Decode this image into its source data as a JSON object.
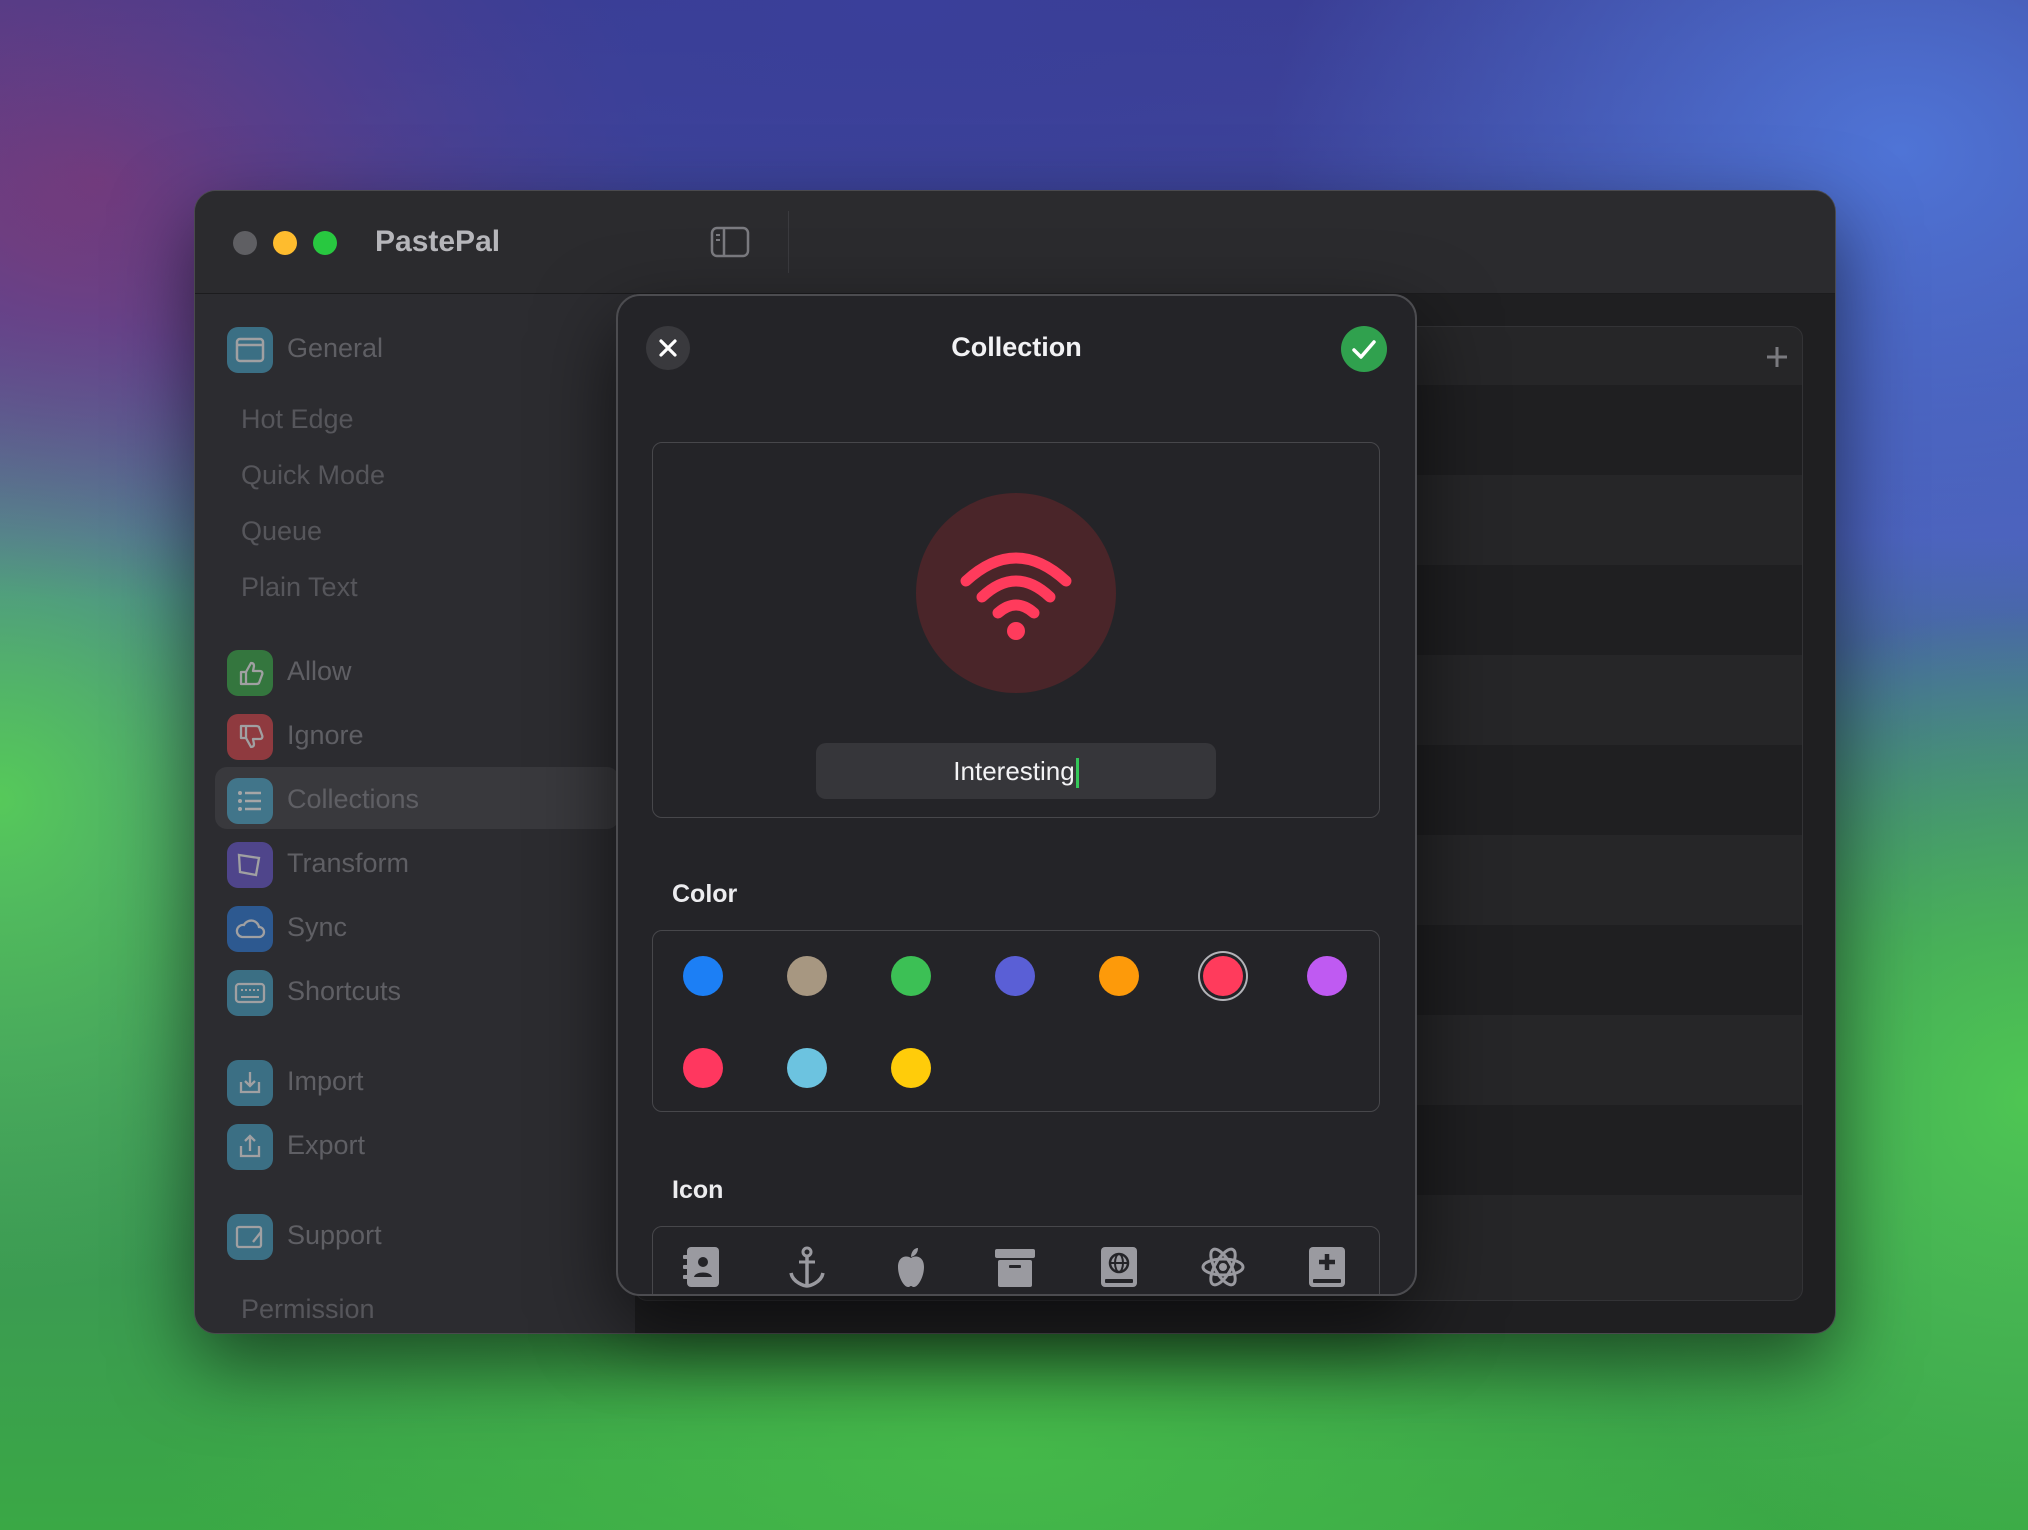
{
  "window": {
    "app_title": "PastePal"
  },
  "sidebar": {
    "items": [
      {
        "label": "General",
        "icon": "window-icon",
        "color": "#48a6c9"
      },
      {
        "label": "Allow",
        "icon": "thumbs-up-icon",
        "color": "#3bb44a"
      },
      {
        "label": "Ignore",
        "icon": "thumbs-down-icon",
        "color": "#e0474c"
      },
      {
        "label": "Collections",
        "icon": "list-icon",
        "color": "#48a6c9"
      },
      {
        "label": "Transform",
        "icon": "transform-icon",
        "color": "#6c5bd6"
      },
      {
        "label": "Sync",
        "icon": "cloud-icon",
        "color": "#2f7fe0"
      },
      {
        "label": "Shortcuts",
        "icon": "keyboard-icon",
        "color": "#48a6c9"
      },
      {
        "label": "Import",
        "icon": "import-icon",
        "color": "#48a6c9"
      },
      {
        "label": "Export",
        "icon": "export-icon",
        "color": "#48a6c9"
      },
      {
        "label": "Support",
        "icon": "support-icon",
        "color": "#48a6c9"
      }
    ],
    "sub_items": [
      "Hot Edge",
      "Quick Mode",
      "Queue",
      "Plain Text",
      "Permission"
    ],
    "active_item": "Collections"
  },
  "modal": {
    "title": "Collection",
    "name_value": "Interesting",
    "preview_icon": "wifi-icon",
    "accent_color": "#ff3b5c",
    "color_label": "Color",
    "icon_label": "Icon",
    "colors": [
      "#1c7ff5",
      "#a79781",
      "#3cc055",
      "#5a5fd6",
      "#fd9a0a",
      "#ff3b5c",
      "#bf5af2",
      "#ff375f",
      "#6cc3e0",
      "#ffcc0a"
    ],
    "selected_color": "#ff3b5c",
    "icons": [
      "contact-book-icon",
      "anchor-icon",
      "apple-icon",
      "archive-box-icon",
      "globe-book-icon",
      "atom-icon",
      "medical-book-icon"
    ]
  }
}
